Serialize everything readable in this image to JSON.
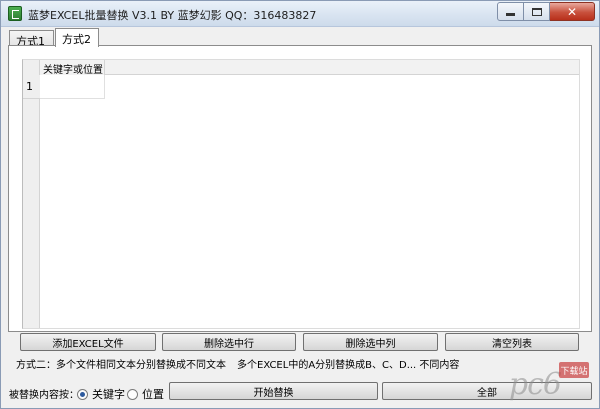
{
  "window": {
    "title": "蓝梦EXCEL批量替换 V3.1 BY 蓝梦幻影 QQ：316483827",
    "controls": {
      "minimize": "",
      "maximize": "",
      "close": "✕"
    }
  },
  "tabs": [
    {
      "label": "方式1",
      "selected": false
    },
    {
      "label": "方式2",
      "selected": true
    }
  ],
  "grid": {
    "columns": [
      "关键字或位置"
    ],
    "rows": [
      {
        "num": "1",
        "cells": [
          ""
        ]
      }
    ]
  },
  "buttons": {
    "add_file": "添加EXCEL文件",
    "delete_row": "删除选中行",
    "delete_col": "删除选中列",
    "clear_list": "清空列表",
    "start_replace": "开始替换",
    "all": "全部"
  },
  "description": {
    "part1": "方式二：多个文件相同文本分别替换成不同文本",
    "part2": "多个EXCEL中的A分别替换成B、C、D... 不同内容"
  },
  "replace_by": {
    "label": "被替换内容按：",
    "options": [
      {
        "label": "关键字",
        "selected": true
      },
      {
        "label": "位置",
        "selected": false
      }
    ]
  },
  "watermark": {
    "text": "pc6",
    "badge": "下载站"
  },
  "colors": {
    "title_bar": "#dce6f2",
    "close_button": "#c8513d",
    "window_bg": "#f0f0f0"
  }
}
